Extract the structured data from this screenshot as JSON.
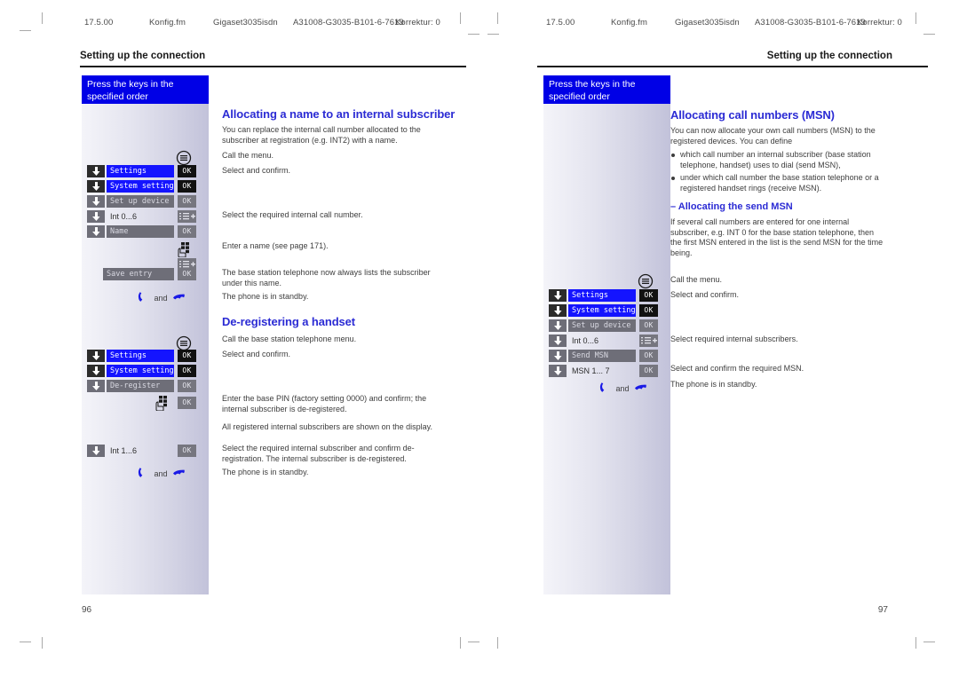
{
  "document": {
    "running_head": {
      "version": "17.5.00",
      "file": "Konfig.fm",
      "product": "Gigaset3035isdn",
      "doc_number": "A31008-G3035-B101-6-7619",
      "correction": "Korrektur: 0"
    },
    "section_title": "Setting up the connection",
    "panel_banner": "Press the keys in the\nspecified order",
    "icons": {
      "menu": "menu-key-icon",
      "ok": "OK",
      "down_arrow": "down-arrow-key-icon",
      "keypad": "keypad-entry-icon",
      "internal_list": "internal-list-key-icon",
      "talk": "talk-key-icon",
      "end_call": "end-call-key-icon",
      "and": "and"
    }
  },
  "left_page": {
    "folio": "96",
    "topic1": {
      "heading": "Allocating a name to an internal subscriber",
      "intro": "You can replace the internal call number allocated to the subscriber at registration (e.g. INT2) with a name.",
      "steps": [
        {
          "icon": "menu",
          "lcd": null,
          "key": null,
          "caption": "Call the menu."
        },
        {
          "icon": "down",
          "lcd": "Settings",
          "lcd_style": "sel",
          "key": "OK",
          "key_style": "dark",
          "caption": "Select and confirm."
        },
        {
          "icon": "down",
          "lcd": "System settings",
          "lcd_style": "sel",
          "key": "OK",
          "key_style": "dark",
          "caption": ""
        },
        {
          "icon": "down",
          "lcd": "Set up device",
          "lcd_style": "gray",
          "key": "OK",
          "key_style": "dim",
          "caption": ""
        },
        {
          "icon": "down",
          "lcd": "Int 0...6",
          "lcd_style": "plain",
          "key": "list",
          "key_style": "dim",
          "caption": "Select the required internal call number."
        },
        {
          "icon": "down",
          "lcd": "Name",
          "lcd_style": "gray",
          "key": "OK",
          "key_style": "dim",
          "caption": ""
        },
        {
          "icon": "keypad",
          "lcd": null,
          "key": null,
          "caption": "Enter a name (see page 171)."
        },
        {
          "icon": "list",
          "lcd": null,
          "key": null,
          "caption": ""
        },
        {
          "icon": null,
          "lcd": "Save entry",
          "lcd_style": "gray",
          "key": "OK",
          "key_style": "dim",
          "caption": "The base station telephone now always lists the subscriber under this name."
        },
        {
          "icon": "handset",
          "lcd": null,
          "key": null,
          "caption": "The phone is in standby."
        }
      ]
    },
    "topic2": {
      "heading": "De-registering a handset",
      "steps": [
        {
          "icon": "menu",
          "lcd": null,
          "key": null,
          "caption": "Call the base station telephone menu."
        },
        {
          "icon": "down",
          "lcd": "Settings",
          "lcd_style": "sel",
          "key": "OK",
          "key_style": "dark",
          "caption": "Select and confirm."
        },
        {
          "icon": "down",
          "lcd": "System settings",
          "lcd_style": "sel",
          "key": "OK",
          "key_style": "dark",
          "caption": ""
        },
        {
          "icon": "down",
          "lcd": "De-register",
          "lcd_style": "gray",
          "key": "OK",
          "key_style": "dim",
          "caption": ""
        },
        {
          "icon": "keypad",
          "lcd": null,
          "key": "OK",
          "key_style": "dim",
          "caption": "Enter the base PIN (factory setting 0000) and confirm; the internal subscriber is de-registered."
        },
        {
          "icon": null,
          "lcd": null,
          "key": null,
          "caption": "All registered internal subscribers are shown on the display."
        },
        {
          "icon": "down",
          "lcd": "Int 1...6",
          "lcd_style": "plain",
          "key": "OK",
          "key_style": "dim",
          "caption": "Select the required internal subscriber and confirm de-registration. The internal subscriber is de-registered."
        },
        {
          "icon": "handset",
          "lcd": null,
          "key": null,
          "caption": "The phone is in standby."
        }
      ]
    }
  },
  "right_page": {
    "folio": "97",
    "topic1": {
      "heading": "Allocating call numbers (MSN)",
      "intro": "You can now allocate your own call numbers (MSN) to the registered devices. You can define",
      "bullets": [
        "which call number an internal subscriber (base station telephone, handset) uses to dial (send MSN),",
        "under which call number the base station telephone or a registered handset rings (receive MSN)."
      ]
    },
    "topic2": {
      "heading": "– Allocating the send MSN",
      "intro": "If several call numbers are entered for one internal subscriber, e.g. INT 0 for the base station telephone, then the first MSN entered in the list is the send MSN for the time being.",
      "steps": [
        {
          "icon": "menu",
          "lcd": null,
          "key": null,
          "caption": "Call the menu."
        },
        {
          "icon": "down",
          "lcd": "Settings",
          "lcd_style": "sel",
          "key": "OK",
          "key_style": "dark",
          "caption": "Select and confirm."
        },
        {
          "icon": "down",
          "lcd": "System settings",
          "lcd_style": "sel",
          "key": "OK",
          "key_style": "dark",
          "caption": ""
        },
        {
          "icon": "down",
          "lcd": "Set up device",
          "lcd_style": "gray",
          "key": "OK",
          "key_style": "dim",
          "caption": ""
        },
        {
          "icon": "down",
          "lcd": "Int 0...6",
          "lcd_style": "plain",
          "key": "list",
          "key_style": "dim",
          "caption": "Select required internal subscribers."
        },
        {
          "icon": "down",
          "lcd": "Send MSN",
          "lcd_style": "gray",
          "key": "OK",
          "key_style": "dim",
          "caption": ""
        },
        {
          "icon": "down",
          "lcd": "MSN 1... 7",
          "lcd_style": "plain",
          "key": "OK",
          "key_style": "dim",
          "caption": "Select and confirm the required MSN."
        },
        {
          "icon": "handset",
          "lcd": null,
          "key": null,
          "caption": "The phone is in standby."
        }
      ]
    }
  },
  "colors": {
    "heading_blue": "#2b2bd4",
    "banner_blue": "#0000e6",
    "lcd_selected": "#1414ff",
    "lcd_gray": "#6e6e78",
    "key_dark": "#111111",
    "body_text": "#3d3d3d"
  }
}
